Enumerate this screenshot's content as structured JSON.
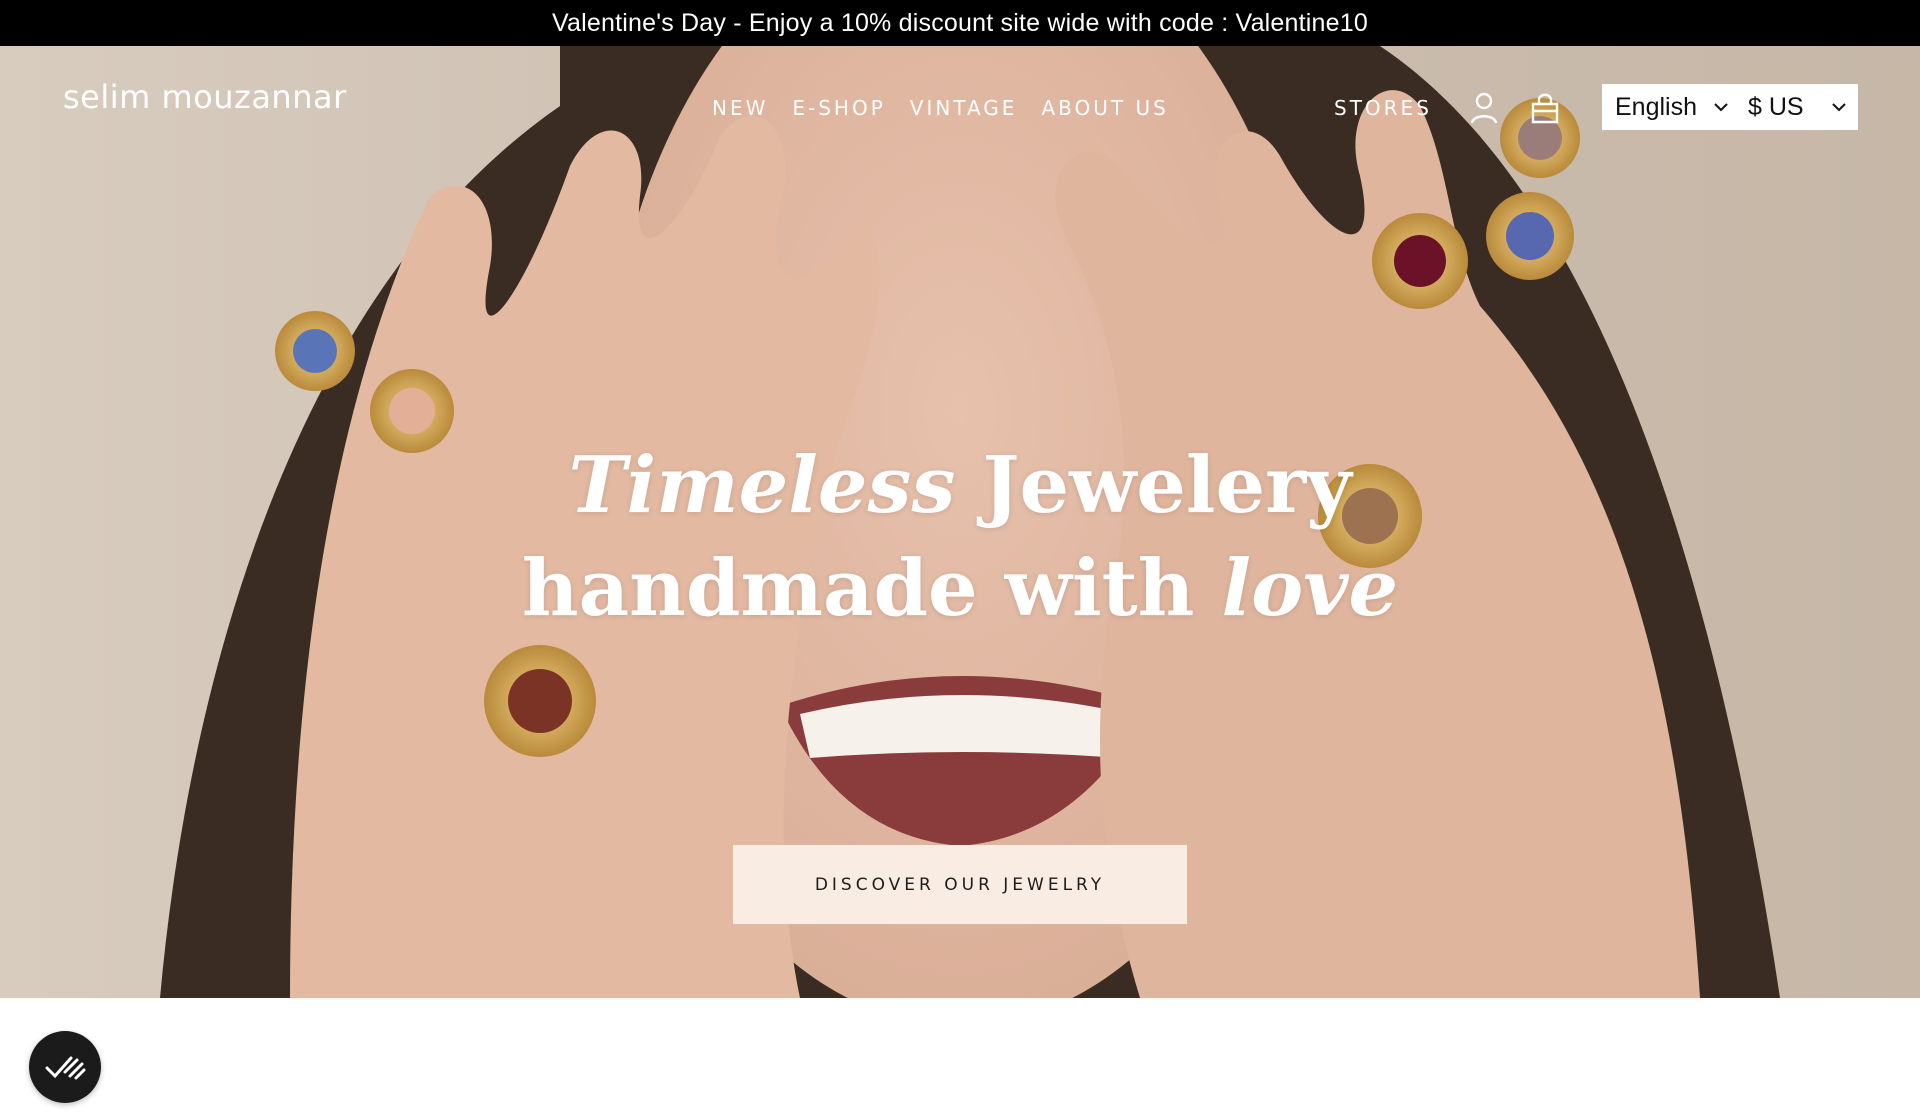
{
  "announcement": {
    "text": "Valentine's Day - Enjoy a 10% discount site wide with code : Valentine10"
  },
  "header": {
    "logo": "selim mouzannar",
    "nav": [
      "NEW",
      "E-SHOP",
      "VINTAGE",
      "ABOUT US"
    ],
    "stores": "STORES",
    "icons": {
      "account": "user-icon",
      "cart": "shopping-bag-icon"
    },
    "language": {
      "selected": "English"
    },
    "currency": {
      "selected": "$ US"
    }
  },
  "hero": {
    "headline_line1_italic": "Timeless",
    "headline_line1_rest": "Jewelery",
    "headline_line2_start": "handmade with",
    "headline_line2_italic": "love",
    "cta_label": "DISCOVER OUR JEWELRY"
  },
  "badge": {
    "icon": "double-check-icon"
  },
  "colors": {
    "announce_bg": "#000000",
    "cta_bg": "#f9ede3",
    "hero_bg": "#cdbfb0",
    "badge_bg": "#1b1b1b"
  }
}
